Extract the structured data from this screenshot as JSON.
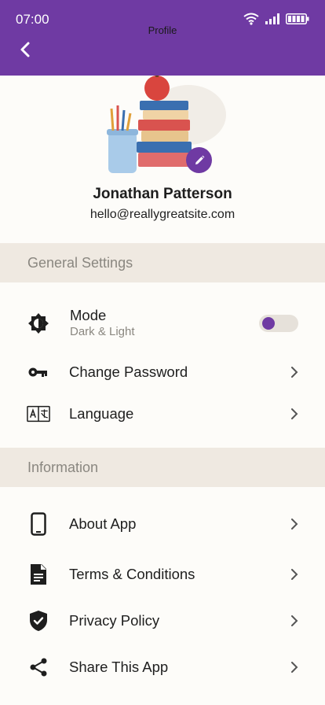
{
  "status_bar": {
    "time": "07:00"
  },
  "header": {
    "title": "Profile"
  },
  "profile": {
    "name": "Jonathan Patterson",
    "email": "hello@reallygreatsite.com"
  },
  "general": {
    "title": "General Settings",
    "mode": {
      "label": "Mode",
      "sub": "Dark & Light",
      "toggle_on": false
    },
    "change_password": "Change Password",
    "language": "Language"
  },
  "information": {
    "title": "Information",
    "about": "About App",
    "terms": "Terms & Conditions",
    "privacy": "Privacy Policy",
    "share": "Share This App"
  },
  "colors": {
    "accent": "#6f3aa3",
    "section_bg": "#efe9e1",
    "background": "#fdfcf9"
  }
}
